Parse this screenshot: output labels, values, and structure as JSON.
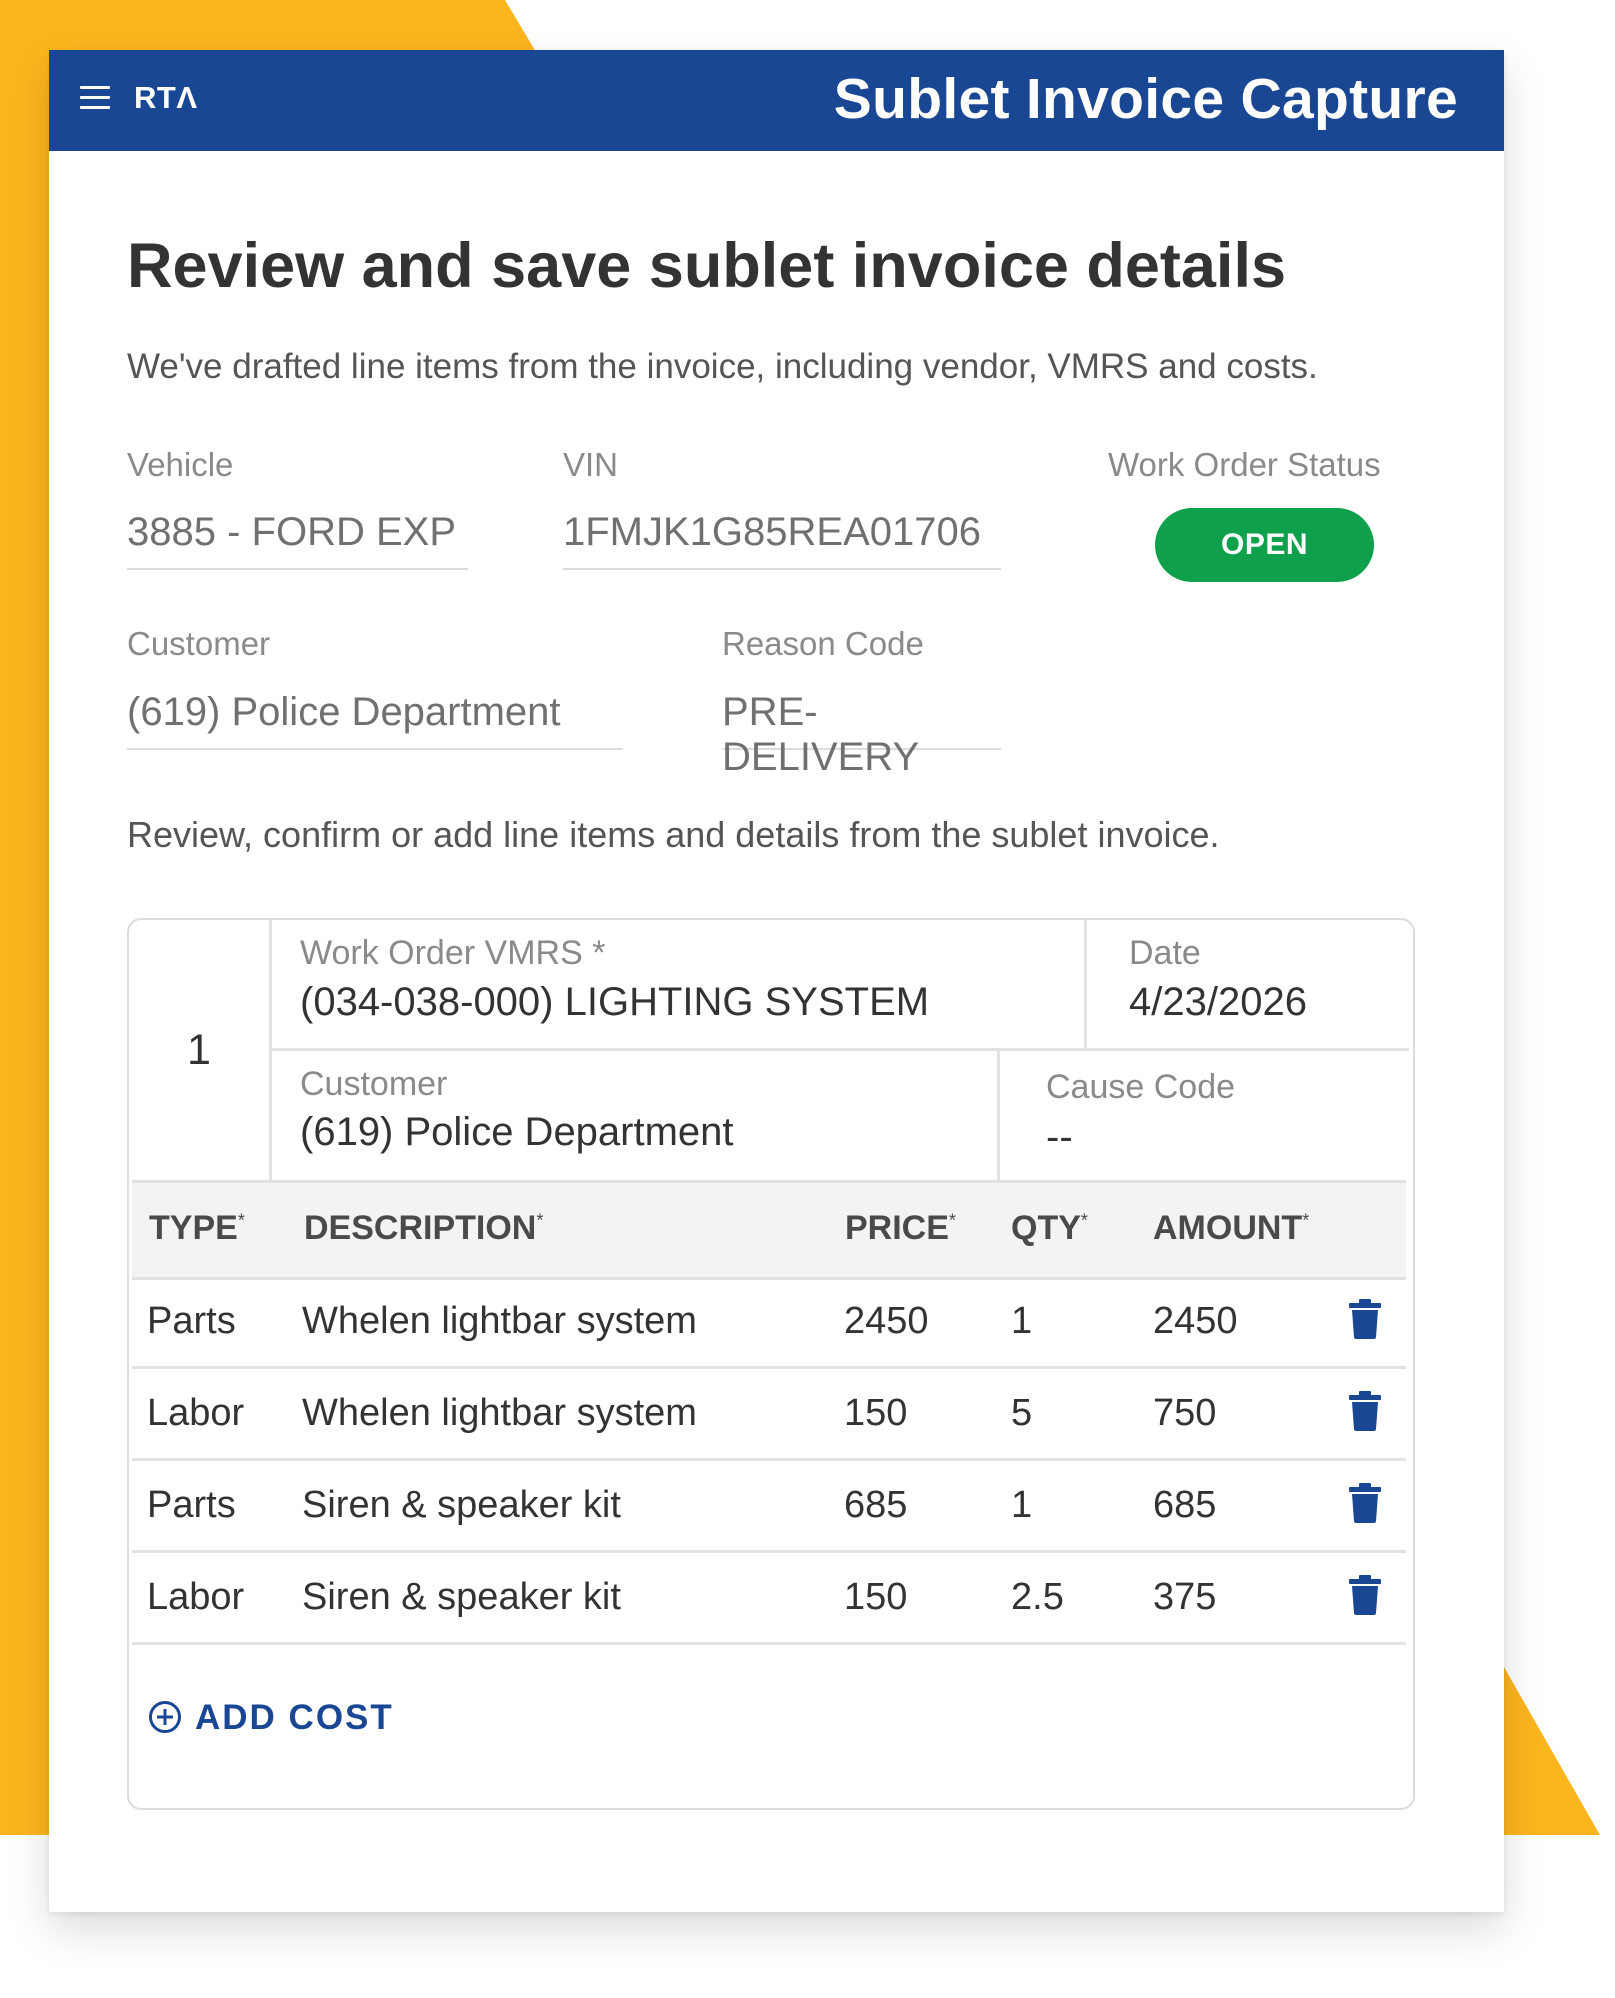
{
  "header": {
    "logo": "RTΛ",
    "app_title": "Sublet Invoice Capture"
  },
  "page": {
    "heading": "Review and save sublet invoice details",
    "subtext": "We've drafted line items from the invoice, including vendor, VMRS and costs.",
    "instruction": "Review, confirm or add line items and details from the sublet invoice."
  },
  "fields": {
    "vehicle": {
      "label": "Vehicle",
      "value": "3885 - FORD EXP"
    },
    "vin": {
      "label": "VIN",
      "value": "1FMJK1G85REA01706"
    },
    "work_order_status": {
      "label": "Work Order Status",
      "value": "OPEN"
    },
    "customer": {
      "label": "Customer",
      "value": "(619) Police Department"
    },
    "reason_code": {
      "label": "Reason Code",
      "value": "PRE-DELIVERY"
    }
  },
  "line_item": {
    "number": "1",
    "vmrs_label": "Work Order VMRS *",
    "vmrs_value": "(034-038-000) LIGHTING SYSTEM",
    "date_label": "Date",
    "date_value": "4/23/2026",
    "customer_label": "Customer",
    "customer_value": "(619) Police Department",
    "cause_code_label": "Cause Code",
    "cause_code_value": "--"
  },
  "table": {
    "columns": [
      {
        "label": "TYPE",
        "req": "*"
      },
      {
        "label": "DESCRIPTION",
        "req": "*"
      },
      {
        "label": "PRICE",
        "req": "*"
      },
      {
        "label": "QTY",
        "req": "*"
      },
      {
        "label": "AMOUNT",
        "req": "*"
      }
    ],
    "rows": [
      {
        "type": "Parts",
        "description": "Whelen lightbar system",
        "price": "2450",
        "qty": "1",
        "amount": "2450"
      },
      {
        "type": "Labor",
        "description": "Whelen lightbar system",
        "price": "150",
        "qty": "5",
        "amount": "750"
      },
      {
        "type": "Parts",
        "description": "Siren & speaker kit",
        "price": "685",
        "qty": "1",
        "amount": "685"
      },
      {
        "type": "Labor",
        "description": "Siren & speaker kit",
        "price": "150",
        "qty": "2.5",
        "amount": "375"
      }
    ]
  },
  "add_cost_label": "ADD COST",
  "icons": {
    "menu": "menu-icon",
    "delete": "trash-icon",
    "add": "plus-circle-icon"
  },
  "colors": {
    "brand_blue": "#1a4793",
    "accent_yellow": "#fdb51e",
    "status_green": "#0ea04b"
  }
}
